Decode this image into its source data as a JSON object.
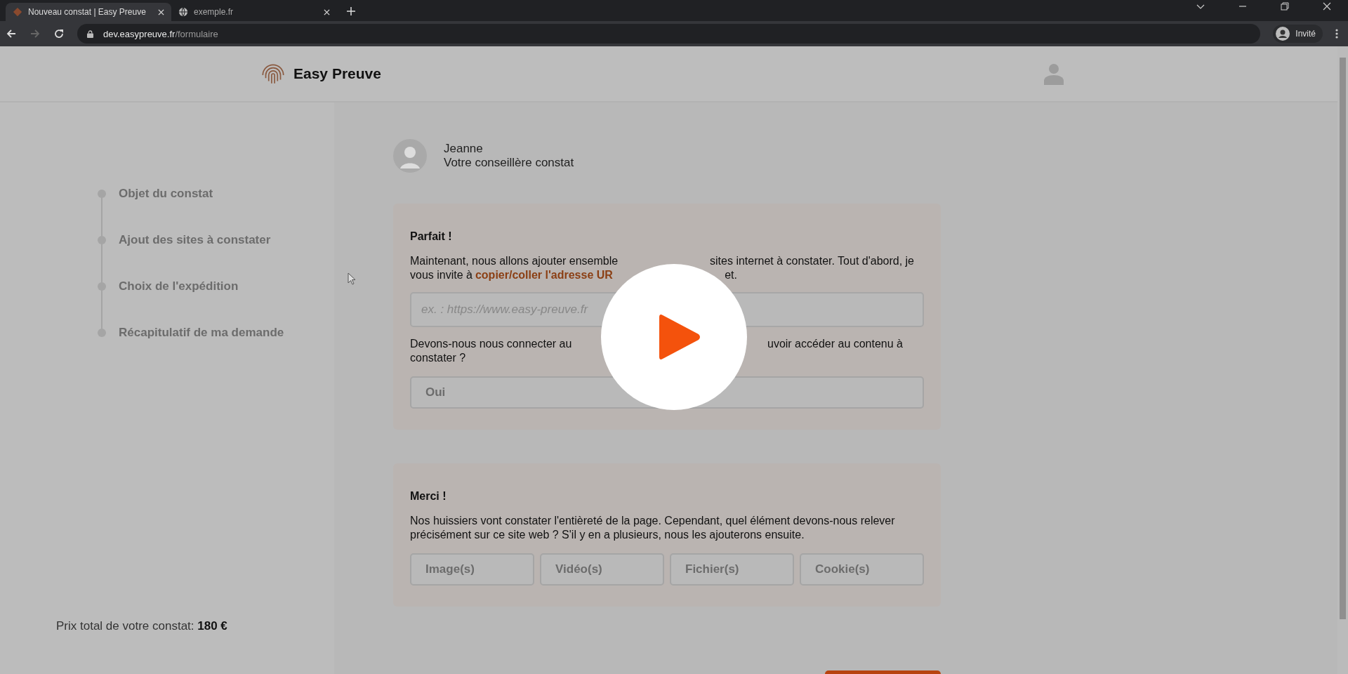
{
  "browser": {
    "tabs": [
      {
        "title": "Nouveau constat | Easy Preuve",
        "selected": true
      },
      {
        "title": "exemple.fr",
        "selected": false
      }
    ],
    "address": {
      "host": "dev.easypreuve.fr",
      "path": "/formulaire"
    },
    "profile": "Invité"
  },
  "header": {
    "brand": "Easy Preuve"
  },
  "steps": [
    {
      "label": "Objet du constat"
    },
    {
      "label": "Ajout des sites à constater"
    },
    {
      "label": "Choix de l'expédition"
    },
    {
      "label": "Récapitulatif de ma demande"
    }
  ],
  "price": {
    "label": "Prix total de votre constat:",
    "value": "180 €"
  },
  "advisor": {
    "name": "Jeanne",
    "role": "Votre conseillère constat"
  },
  "card1": {
    "title": "Parfait !",
    "intro": [
      [
        {
          "kind": "text",
          "text": "Maintenant, nous allons ajouter ensemble"
        },
        {
          "kind": "gap"
        },
        {
          "kind": "text",
          "text": "sites internet à constater. Tout d'abord, je"
        }
      ],
      [
        {
          "kind": "text",
          "text": "vous invite à"
        },
        {
          "kind": "link",
          "text": "copier/coller l'adresse UR"
        },
        {
          "kind": "gap"
        },
        {
          "kind": "text",
          "text": "et."
        }
      ]
    ],
    "url_field": {
      "placeholder": "ex. : https://www.easy-preuve.fr"
    },
    "question": [
      [
        {
          "kind": "text",
          "text": "Devons-nous nous connecter au"
        },
        {
          "kind": "gap"
        },
        {
          "kind": "text",
          "text": "uvoir accéder au contenu à"
        }
      ],
      [
        {
          "kind": "text",
          "text": "constater ?"
        }
      ]
    ],
    "choices": [
      {
        "label": "Oui"
      }
    ]
  },
  "card2": {
    "title": "Merci !",
    "text": "Nos huissiers vont constater l'entièreté de la page. Cependant, quel élément devons-nous relever précisément sur ce site web ? S'il y en a plusieurs, nous les ajouterons ensuite.",
    "choices": [
      {
        "label": "Image(s)"
      },
      {
        "label": "Vidéo(s)"
      },
      {
        "label": "Fichier(s)"
      },
      {
        "label": "Cookie(s)"
      }
    ]
  }
}
